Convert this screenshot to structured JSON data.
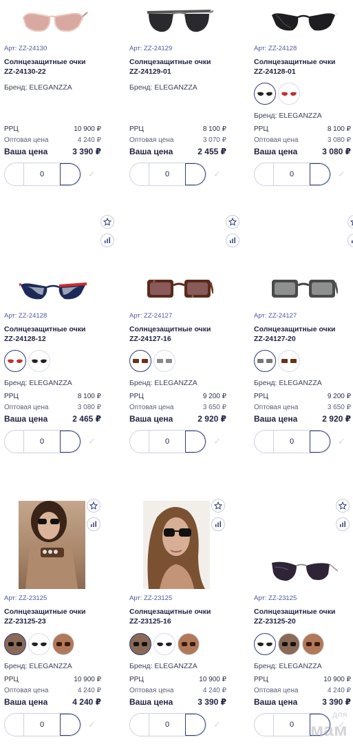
{
  "labels": {
    "rrc": "РРЦ",
    "wholesale": "Оптовая цена",
    "your_price": "Ваша цена",
    "brand_prefix": "Бренд: "
  },
  "products": [
    {
      "art": "Арт: ZZ-24130",
      "title": "Солнцезащитные очки",
      "model": "ZZ-24130-22",
      "brand": "Бренд: ELEGANZZA",
      "rrc": "10 900 ₽",
      "wholesale": "4 240 ₽",
      "price": "3 390 ₽",
      "qty": "0",
      "swatches": []
    },
    {
      "art": "Арт: ZZ-24129",
      "title": "Солнцезащитные очки",
      "model": "ZZ-24129-01",
      "brand": "Бренд: ELEGANZZA",
      "rrc": "8 100 ₽",
      "wholesale": "3 070 ₽",
      "price": "2 455 ₽",
      "qty": "0",
      "swatches": []
    },
    {
      "art": "Арт: ZZ-24128",
      "title": "Солнцезащитные очки",
      "model": "ZZ-24128-01",
      "brand": "Бренд: ELEGANZZA",
      "rrc": "8 100 ₽",
      "wholesale": "3 080 ₽",
      "price": "3 080 ₽",
      "qty": "0",
      "swatches": [
        "black",
        "red"
      ]
    },
    {
      "art": "Арт: ZZ-24128",
      "title": "Солнцезащитные очки",
      "model": "ZZ-24128-12",
      "brand": "Бренд: ELEGANZZA",
      "rrc": "8 100 ₽",
      "wholesale": "3 080 ₽",
      "price": "2 465 ₽",
      "qty": "0",
      "swatches": [
        "red",
        "black"
      ]
    },
    {
      "art": "Арт: ZZ-24127",
      "title": "Солнцезащитные очки",
      "model": "ZZ-24127-16",
      "brand": "Бренд: ELEGANZZA",
      "rrc": "9 200 ₽",
      "wholesale": "3 650 ₽",
      "price": "2 920 ₽",
      "qty": "0",
      "swatches": [
        "tortoise",
        "grey"
      ]
    },
    {
      "art": "Арт: ZZ-24127",
      "title": "Солнцезащитные очки",
      "model": "ZZ-24127-20",
      "brand": "Бренд: ELEGANZZA",
      "rrc": "9 200 ₽",
      "wholesale": "3 650 ₽",
      "price": "2 920 ₽",
      "qty": "0",
      "swatches": [
        "grey",
        "tortoise"
      ]
    },
    {
      "art": "Арт: ZZ-23125",
      "title": "Солнцезащитные очки",
      "model": "ZZ-23125-23",
      "brand": "Бренд: ELEGANZZA",
      "rrc": "10 900 ₽",
      "wholesale": "4 240 ₽",
      "price": "4 240 ₽",
      "qty": "0",
      "swatches": [
        "photo-dark",
        "black",
        "photo-tortoise"
      ]
    },
    {
      "art": "Арт: ZZ-23125",
      "title": "Солнцезащитные очки",
      "model": "ZZ-23125-16",
      "brand": "Бренд: ELEGANZZA",
      "rrc": "10 900 ₽",
      "wholesale": "4 240 ₽",
      "price": "3 390 ₽",
      "qty": "0",
      "swatches": [
        "photo-dark",
        "black",
        "photo-tortoise"
      ]
    },
    {
      "art": "Арт: ZZ-23125",
      "title": "Солнцезащитные очки",
      "model": "ZZ-23125-20",
      "brand": "Бренд: ELEGANZZA",
      "rrc": "10 900 ₽",
      "wholesale": "4 240 ₽",
      "price": "3 390 ₽",
      "qty": "0",
      "swatches": [
        "black",
        "photo-dark",
        "photo-tortoise"
      ]
    }
  ],
  "icons": {
    "favorite": "star-icon",
    "compare": "compare-chart-icon",
    "confirm": "check-icon"
  },
  "colors": {
    "accent": "#2b3a7a",
    "text": "#1e2240",
    "muted": "#4b5a9a",
    "border": "#cdd1e2"
  },
  "watermark": {
    "top": "для",
    "bottom": "мам"
  }
}
